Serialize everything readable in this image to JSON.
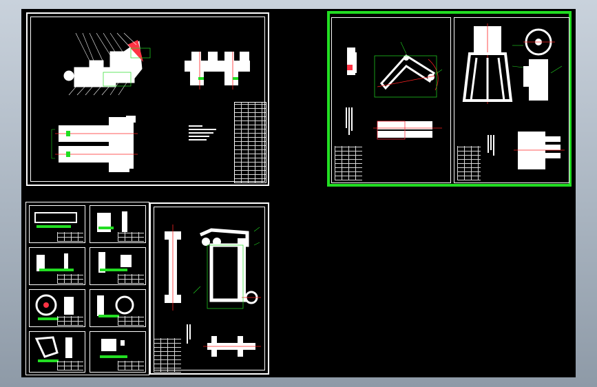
{
  "viewer": {
    "background": "#000000",
    "selection_color": "#22dd22",
    "line_color": "#ffffff",
    "center_line_color": "#ff2222"
  },
  "sheets": [
    {
      "id": "assembly-sheet",
      "label": "",
      "selected": false
    },
    {
      "id": "arm-sheet",
      "label": "",
      "selected": true
    },
    {
      "id": "gripper-sheet",
      "label": "",
      "selected": true
    },
    {
      "id": "thumbnails-sheet",
      "label": "",
      "selected": false
    },
    {
      "id": "linkage-sheet",
      "label": "",
      "selected": false
    }
  ],
  "icons": [
    "drawing-sheet-icon",
    "title-block-icon"
  ]
}
